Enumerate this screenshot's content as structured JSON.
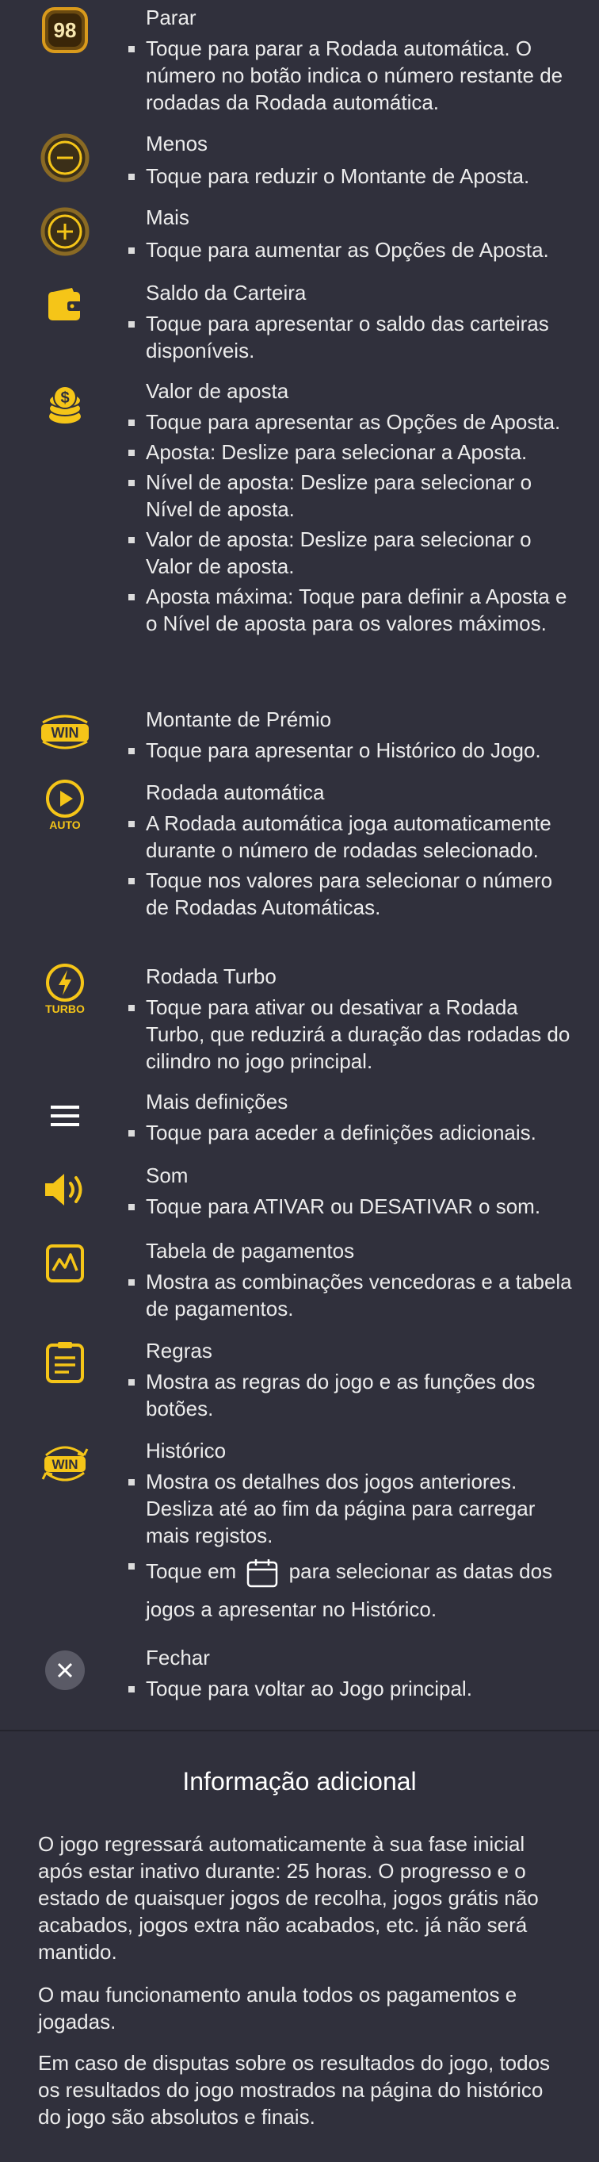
{
  "items": [
    {
      "icon": "autospin-stop-icon",
      "icon_text": "98",
      "title": "Parar",
      "bullets": [
        "Toque para parar a Rodada automática. O número no botão indica o número restante de rodadas da Rodada automática."
      ]
    },
    {
      "icon": "minus-icon",
      "title": "Menos",
      "bullets": [
        "Toque para reduzir o Montante de Aposta."
      ]
    },
    {
      "icon": "plus-icon",
      "title": "Mais",
      "bullets": [
        "Toque para aumentar as Opções de Aposta."
      ]
    },
    {
      "icon": "wallet-icon",
      "title": "Saldo da Carteira",
      "bullets": [
        "Toque para apresentar o saldo das carteiras disponíveis."
      ]
    },
    {
      "icon": "coins-icon",
      "title": "Valor de aposta",
      "bullets": [
        "Toque para apresentar as Opções de Aposta.",
        "Aposta: Deslize para selecionar a Aposta.",
        "Nível de aposta: Deslize para selecionar o Nível de aposta.",
        "Valor de aposta: Deslize para selecionar o Valor de aposta.",
        "Aposta máxima: Toque para definir a Aposta e o Nível de aposta para os valores máximos."
      ]
    },
    {
      "icon": "win-icon",
      "icon_text": "WIN",
      "title": "Montante de Prémio",
      "bullets": [
        "Toque para apresentar o Histórico do Jogo."
      ]
    },
    {
      "icon": "auto-spin-icon",
      "icon_text": "AUTO",
      "title": "Rodada automática",
      "bullets": [
        "A Rodada automática joga automaticamente durante o número de rodadas selecionado.",
        "Toque nos valores para selecionar o número de Rodadas Automáticas."
      ]
    },
    {
      "icon": "turbo-icon",
      "icon_text": "TURBO",
      "title": "Rodada Turbo",
      "bullets": [
        "Toque para ativar ou desativar a Rodada Turbo, que reduzirá a duração das rodadas do cilindro no jogo principal."
      ]
    },
    {
      "icon": "menu-icon",
      "title": "Mais definições",
      "bullets": [
        "Toque para aceder a definições adicionais."
      ]
    },
    {
      "icon": "sound-icon",
      "title": "Som",
      "bullets": [
        "Toque para ATIVAR ou DESATIVAR o som."
      ]
    },
    {
      "icon": "paytable-icon",
      "title": "Tabela de pagamentos",
      "bullets": [
        "Mostra as combinações vencedoras e a tabela de pagamentos."
      ]
    },
    {
      "icon": "rules-icon",
      "title": "Regras",
      "bullets": [
        "Mostra as regras do jogo e as funções dos botões."
      ]
    },
    {
      "icon": "history-icon",
      "icon_text": "WIN",
      "title": "Histórico",
      "bullets": [
        "Mostra os detalhes dos jogos anteriores. Desliza até ao fim da página para carregar mais registos."
      ],
      "extra": {
        "before": "Toque em",
        "after": "para selecionar as datas dos",
        "line2": "jogos a apresentar no Histórico."
      }
    },
    {
      "icon": "close-icon",
      "title": "Fechar",
      "bullets": [
        "Toque para voltar ao Jogo principal."
      ]
    }
  ],
  "additional": {
    "title": "Informação adicional",
    "paragraphs": [
      "O jogo regressará automaticamente à sua fase inicial após estar inativo durante: 25 horas. O progresso e o estado de quaisquer jogos de recolha, jogos grátis não acabados, jogos extra não acabados, etc. já não será mantido.",
      "O mau funcionamento anula todos os pagamentos e jogadas.",
      "Em caso de disputas sobre os resultados do jogo, todos os resultados do jogo mostrados na página do histórico do jogo são absolutos e finais."
    ]
  },
  "colors": {
    "accent": "#f5c518",
    "background": "#30303c"
  }
}
